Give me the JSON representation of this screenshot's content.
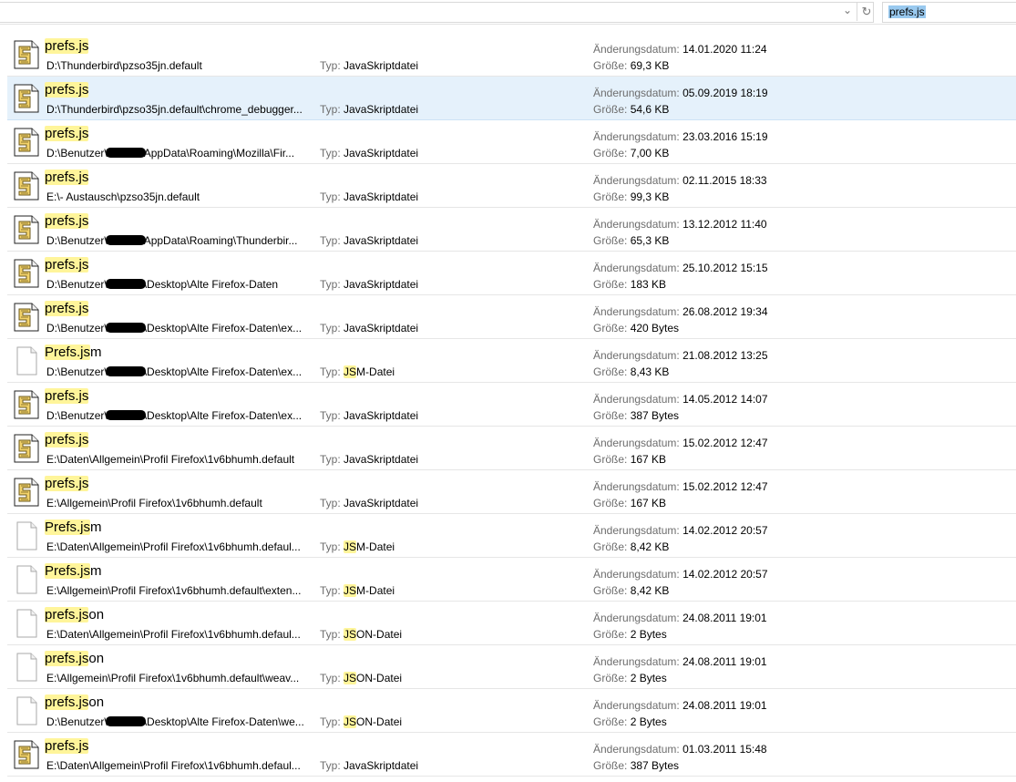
{
  "search": {
    "query": "prefs.js"
  },
  "labels": {
    "type": "Typ:",
    "date": "Änderungsdatum:",
    "size": "Größe:"
  },
  "rows": [
    {
      "icon": "js",
      "name_hl": "prefs.js",
      "name_rest": "",
      "path_pre": "D:\\Thunderbird\\pzso35jn.default",
      "redacted": false,
      "path_post": "",
      "type_hl": "",
      "type_rest": "JavaSkriptdatei",
      "date": "14.01.2020 11:24",
      "size": "69,3 KB"
    },
    {
      "icon": "js",
      "name_hl": "prefs.js",
      "name_rest": "",
      "path_pre": "D:\\Thunderbird\\pzso35jn.default\\chrome_debugger...",
      "redacted": false,
      "path_post": "",
      "type_hl": "",
      "type_rest": "JavaSkriptdatei",
      "date": "05.09.2019 18:19",
      "size": "54,6 KB",
      "selected": true
    },
    {
      "icon": "js",
      "name_hl": "prefs.js",
      "name_rest": "",
      "path_pre": "D:\\Benutzer\\",
      "redacted": true,
      "path_post": "AppData\\Roaming\\Mozilla\\Fir...",
      "type_hl": "",
      "type_rest": "JavaSkriptdatei",
      "date": "23.03.2016 15:19",
      "size": "7,00 KB"
    },
    {
      "icon": "js",
      "name_hl": "prefs.js",
      "name_rest": "",
      "path_pre": "E:\\- Austausch\\pzso35jn.default",
      "redacted": false,
      "path_post": "",
      "type_hl": "",
      "type_rest": "JavaSkriptdatei",
      "date": "02.11.2015 18:33",
      "size": "99,3 KB"
    },
    {
      "icon": "js",
      "name_hl": "prefs.js",
      "name_rest": "",
      "path_pre": "D:\\Benutzer\\",
      "redacted": true,
      "path_post": "AppData\\Roaming\\Thunderbir...",
      "type_hl": "",
      "type_rest": "JavaSkriptdatei",
      "date": "13.12.2012 11:40",
      "size": "65,3 KB"
    },
    {
      "icon": "js",
      "name_hl": "prefs.js",
      "name_rest": "",
      "path_pre": "D:\\Benutzer\\",
      "redacted": true,
      "path_post": "\\Desktop\\Alte Firefox-Daten",
      "type_hl": "",
      "type_rest": "JavaSkriptdatei",
      "date": "25.10.2012 15:15",
      "size": "183 KB"
    },
    {
      "icon": "js",
      "name_hl": "prefs.js",
      "name_rest": "",
      "path_pre": "D:\\Benutzer\\",
      "redacted": true,
      "path_post": "\\Desktop\\Alte Firefox-Daten\\ex...",
      "type_hl": "",
      "type_rest": "JavaSkriptdatei",
      "date": "26.08.2012 19:34",
      "size": "420 Bytes"
    },
    {
      "icon": "blank",
      "name_hl": "Prefs.js",
      "name_rest": "m",
      "path_pre": "D:\\Benutzer\\",
      "redacted": true,
      "path_post": "\\Desktop\\Alte Firefox-Daten\\ex...",
      "type_hl": "JS",
      "type_rest": "M-Datei",
      "date": "21.08.2012 13:25",
      "size": "8,43 KB"
    },
    {
      "icon": "js",
      "name_hl": "prefs.js",
      "name_rest": "",
      "path_pre": "D:\\Benutzer\\",
      "redacted": true,
      "path_post": "\\Desktop\\Alte Firefox-Daten\\ex...",
      "type_hl": "",
      "type_rest": "JavaSkriptdatei",
      "date": "14.05.2012 14:07",
      "size": "387 Bytes"
    },
    {
      "icon": "js",
      "name_hl": "prefs.js",
      "name_rest": "",
      "path_pre": "E:\\Daten\\Allgemein\\Profil Firefox\\1v6bhumh.default",
      "redacted": false,
      "path_post": "",
      "type_hl": "",
      "type_rest": "JavaSkriptdatei",
      "date": "15.02.2012 12:47",
      "size": "167 KB"
    },
    {
      "icon": "js",
      "name_hl": "prefs.js",
      "name_rest": "",
      "path_pre": "E:\\Allgemein\\Profil Firefox\\1v6bhumh.default",
      "redacted": false,
      "path_post": "",
      "type_hl": "",
      "type_rest": "JavaSkriptdatei",
      "date": "15.02.2012 12:47",
      "size": "167 KB"
    },
    {
      "icon": "blank",
      "name_hl": "Prefs.js",
      "name_rest": "m",
      "path_pre": "E:\\Daten\\Allgemein\\Profil Firefox\\1v6bhumh.defaul...",
      "redacted": false,
      "path_post": "",
      "type_hl": "JS",
      "type_rest": "M-Datei",
      "date": "14.02.2012 20:57",
      "size": "8,42 KB"
    },
    {
      "icon": "blank",
      "name_hl": "Prefs.js",
      "name_rest": "m",
      "path_pre": "E:\\Allgemein\\Profil Firefox\\1v6bhumh.default\\exten...",
      "redacted": false,
      "path_post": "",
      "type_hl": "JS",
      "type_rest": "M-Datei",
      "date": "14.02.2012 20:57",
      "size": "8,42 KB"
    },
    {
      "icon": "blank",
      "name_hl": "prefs.js",
      "name_rest": "on",
      "path_pre": "E:\\Daten\\Allgemein\\Profil Firefox\\1v6bhumh.defaul...",
      "redacted": false,
      "path_post": "",
      "type_hl": "JS",
      "type_rest": "ON-Datei",
      "date": "24.08.2011 19:01",
      "size": "2 Bytes"
    },
    {
      "icon": "blank",
      "name_hl": "prefs.js",
      "name_rest": "on",
      "path_pre": "E:\\Allgemein\\Profil Firefox\\1v6bhumh.default\\weav...",
      "redacted": false,
      "path_post": "",
      "type_hl": "JS",
      "type_rest": "ON-Datei",
      "date": "24.08.2011 19:01",
      "size": "2 Bytes"
    },
    {
      "icon": "blank",
      "name_hl": "prefs.js",
      "name_rest": "on",
      "path_pre": "D:\\Benutzer\\",
      "redacted": true,
      "path_post": "\\Desktop\\Alte Firefox-Daten\\we...",
      "type_hl": "JS",
      "type_rest": "ON-Datei",
      "date": "24.08.2011 19:01",
      "size": "2 Bytes"
    },
    {
      "icon": "js",
      "name_hl": "prefs.js",
      "name_rest": "",
      "path_pre": "E:\\Daten\\Allgemein\\Profil Firefox\\1v6bhumh.defaul...",
      "redacted": false,
      "path_post": "",
      "type_hl": "",
      "type_rest": "JavaSkriptdatei",
      "date": "01.03.2011 15:48",
      "size": "387 Bytes"
    }
  ]
}
